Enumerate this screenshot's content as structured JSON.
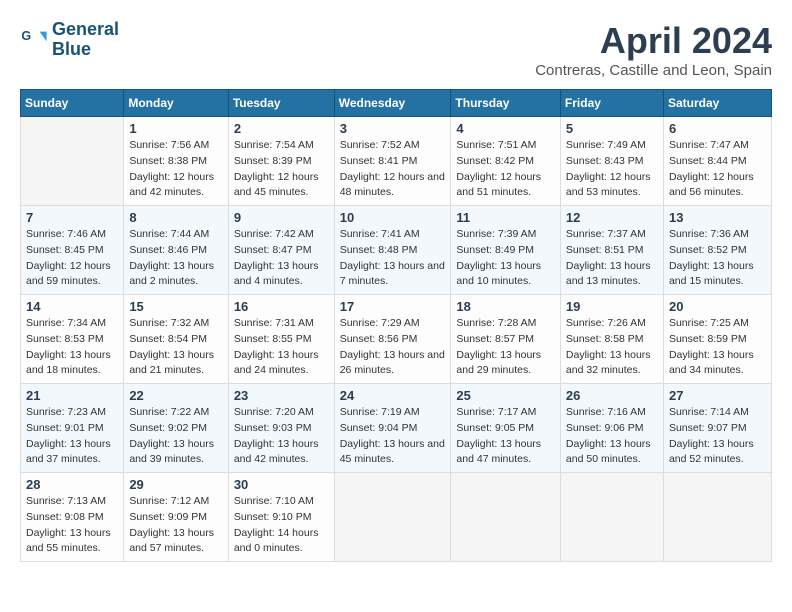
{
  "header": {
    "logo_line1": "General",
    "logo_line2": "Blue",
    "month_year": "April 2024",
    "location": "Contreras, Castille and Leon, Spain"
  },
  "days_of_week": [
    "Sunday",
    "Monday",
    "Tuesday",
    "Wednesday",
    "Thursday",
    "Friday",
    "Saturday"
  ],
  "weeks": [
    [
      {
        "day": "",
        "empty": true
      },
      {
        "day": "1",
        "sunrise": "Sunrise: 7:56 AM",
        "sunset": "Sunset: 8:38 PM",
        "daylight": "Daylight: 12 hours and 42 minutes."
      },
      {
        "day": "2",
        "sunrise": "Sunrise: 7:54 AM",
        "sunset": "Sunset: 8:39 PM",
        "daylight": "Daylight: 12 hours and 45 minutes."
      },
      {
        "day": "3",
        "sunrise": "Sunrise: 7:52 AM",
        "sunset": "Sunset: 8:41 PM",
        "daylight": "Daylight: 12 hours and 48 minutes."
      },
      {
        "day": "4",
        "sunrise": "Sunrise: 7:51 AM",
        "sunset": "Sunset: 8:42 PM",
        "daylight": "Daylight: 12 hours and 51 minutes."
      },
      {
        "day": "5",
        "sunrise": "Sunrise: 7:49 AM",
        "sunset": "Sunset: 8:43 PM",
        "daylight": "Daylight: 12 hours and 53 minutes."
      },
      {
        "day": "6",
        "sunrise": "Sunrise: 7:47 AM",
        "sunset": "Sunset: 8:44 PM",
        "daylight": "Daylight: 12 hours and 56 minutes."
      }
    ],
    [
      {
        "day": "7",
        "sunrise": "Sunrise: 7:46 AM",
        "sunset": "Sunset: 8:45 PM",
        "daylight": "Daylight: 12 hours and 59 minutes."
      },
      {
        "day": "8",
        "sunrise": "Sunrise: 7:44 AM",
        "sunset": "Sunset: 8:46 PM",
        "daylight": "Daylight: 13 hours and 2 minutes."
      },
      {
        "day": "9",
        "sunrise": "Sunrise: 7:42 AM",
        "sunset": "Sunset: 8:47 PM",
        "daylight": "Daylight: 13 hours and 4 minutes."
      },
      {
        "day": "10",
        "sunrise": "Sunrise: 7:41 AM",
        "sunset": "Sunset: 8:48 PM",
        "daylight": "Daylight: 13 hours and 7 minutes."
      },
      {
        "day": "11",
        "sunrise": "Sunrise: 7:39 AM",
        "sunset": "Sunset: 8:49 PM",
        "daylight": "Daylight: 13 hours and 10 minutes."
      },
      {
        "day": "12",
        "sunrise": "Sunrise: 7:37 AM",
        "sunset": "Sunset: 8:51 PM",
        "daylight": "Daylight: 13 hours and 13 minutes."
      },
      {
        "day": "13",
        "sunrise": "Sunrise: 7:36 AM",
        "sunset": "Sunset: 8:52 PM",
        "daylight": "Daylight: 13 hours and 15 minutes."
      }
    ],
    [
      {
        "day": "14",
        "sunrise": "Sunrise: 7:34 AM",
        "sunset": "Sunset: 8:53 PM",
        "daylight": "Daylight: 13 hours and 18 minutes."
      },
      {
        "day": "15",
        "sunrise": "Sunrise: 7:32 AM",
        "sunset": "Sunset: 8:54 PM",
        "daylight": "Daylight: 13 hours and 21 minutes."
      },
      {
        "day": "16",
        "sunrise": "Sunrise: 7:31 AM",
        "sunset": "Sunset: 8:55 PM",
        "daylight": "Daylight: 13 hours and 24 minutes."
      },
      {
        "day": "17",
        "sunrise": "Sunrise: 7:29 AM",
        "sunset": "Sunset: 8:56 PM",
        "daylight": "Daylight: 13 hours and 26 minutes."
      },
      {
        "day": "18",
        "sunrise": "Sunrise: 7:28 AM",
        "sunset": "Sunset: 8:57 PM",
        "daylight": "Daylight: 13 hours and 29 minutes."
      },
      {
        "day": "19",
        "sunrise": "Sunrise: 7:26 AM",
        "sunset": "Sunset: 8:58 PM",
        "daylight": "Daylight: 13 hours and 32 minutes."
      },
      {
        "day": "20",
        "sunrise": "Sunrise: 7:25 AM",
        "sunset": "Sunset: 8:59 PM",
        "daylight": "Daylight: 13 hours and 34 minutes."
      }
    ],
    [
      {
        "day": "21",
        "sunrise": "Sunrise: 7:23 AM",
        "sunset": "Sunset: 9:01 PM",
        "daylight": "Daylight: 13 hours and 37 minutes."
      },
      {
        "day": "22",
        "sunrise": "Sunrise: 7:22 AM",
        "sunset": "Sunset: 9:02 PM",
        "daylight": "Daylight: 13 hours and 39 minutes."
      },
      {
        "day": "23",
        "sunrise": "Sunrise: 7:20 AM",
        "sunset": "Sunset: 9:03 PM",
        "daylight": "Daylight: 13 hours and 42 minutes."
      },
      {
        "day": "24",
        "sunrise": "Sunrise: 7:19 AM",
        "sunset": "Sunset: 9:04 PM",
        "daylight": "Daylight: 13 hours and 45 minutes."
      },
      {
        "day": "25",
        "sunrise": "Sunrise: 7:17 AM",
        "sunset": "Sunset: 9:05 PM",
        "daylight": "Daylight: 13 hours and 47 minutes."
      },
      {
        "day": "26",
        "sunrise": "Sunrise: 7:16 AM",
        "sunset": "Sunset: 9:06 PM",
        "daylight": "Daylight: 13 hours and 50 minutes."
      },
      {
        "day": "27",
        "sunrise": "Sunrise: 7:14 AM",
        "sunset": "Sunset: 9:07 PM",
        "daylight": "Daylight: 13 hours and 52 minutes."
      }
    ],
    [
      {
        "day": "28",
        "sunrise": "Sunrise: 7:13 AM",
        "sunset": "Sunset: 9:08 PM",
        "daylight": "Daylight: 13 hours and 55 minutes."
      },
      {
        "day": "29",
        "sunrise": "Sunrise: 7:12 AM",
        "sunset": "Sunset: 9:09 PM",
        "daylight": "Daylight: 13 hours and 57 minutes."
      },
      {
        "day": "30",
        "sunrise": "Sunrise: 7:10 AM",
        "sunset": "Sunset: 9:10 PM",
        "daylight": "Daylight: 14 hours and 0 minutes."
      },
      {
        "day": "",
        "empty": true
      },
      {
        "day": "",
        "empty": true
      },
      {
        "day": "",
        "empty": true
      },
      {
        "day": "",
        "empty": true
      }
    ]
  ]
}
